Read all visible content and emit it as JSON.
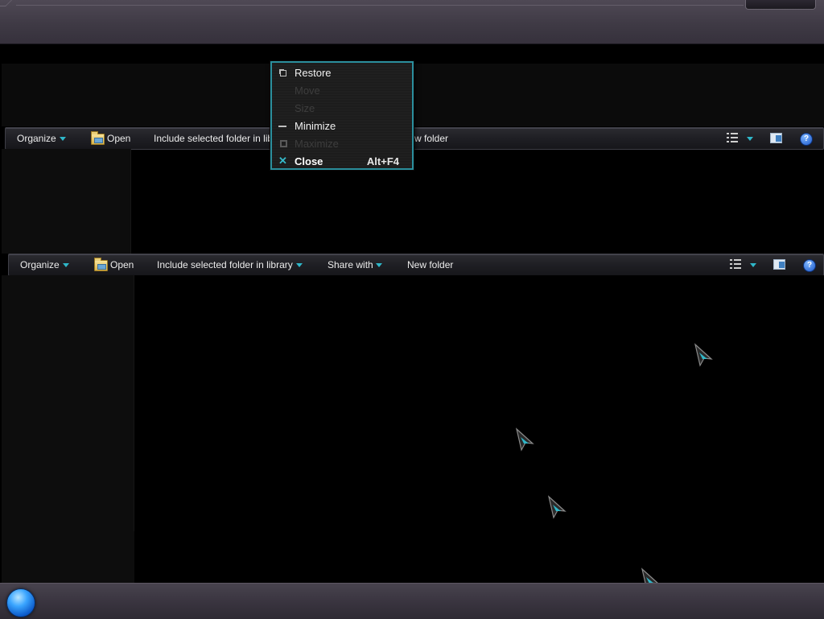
{
  "toolbar_top": {
    "organize": "Organize",
    "open": "Open",
    "include_truncated": "Include selected folder in lib",
    "new_folder_truncated": "w folder"
  },
  "toolbar_main": {
    "organize": "Organize",
    "open": "Open",
    "include": "Include selected folder in library",
    "share": "Share with",
    "new_folder": "New folder"
  },
  "context_menu": {
    "items": [
      {
        "label": "Restore",
        "enabled": true
      },
      {
        "label": "Move",
        "enabled": false
      },
      {
        "label": "Size",
        "enabled": false
      },
      {
        "label": "Minimize",
        "enabled": true
      },
      {
        "label": "Maximize",
        "enabled": false
      },
      {
        "label": "Close",
        "enabled": true,
        "shortcut": "Alt+F4"
      }
    ]
  },
  "icons": {
    "dropdown": "chevron-down-icon",
    "folder": "folder-open-icon",
    "views": "change-view-icon",
    "preview": "preview-pane-icon",
    "help": "help-icon",
    "start": "start-orb"
  },
  "colors": {
    "accent": "#2fb7c9",
    "menu_border": "#2b8f9d"
  }
}
